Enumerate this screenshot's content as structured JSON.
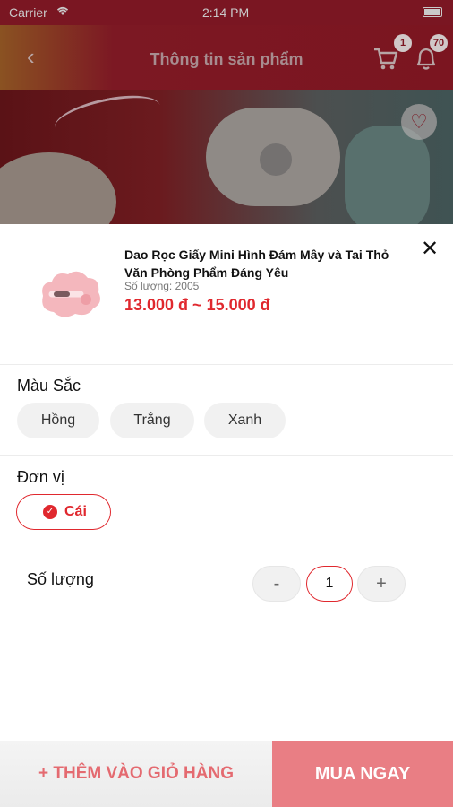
{
  "status_bar": {
    "carrier": "Carrier",
    "time": "2:14 PM"
  },
  "nav": {
    "title": "Thông tin sản phẩm",
    "cart_badge": "1",
    "notification_badge": "70"
  },
  "product": {
    "name": "Dao Rọc Giấy Mini Hình Đám Mây và Tai Thỏ Văn Phòng Phẩm Đáng Yêu",
    "quantity_text": "Số lượng: 2005",
    "price_range": "13.000 đ ~ 15.000 đ"
  },
  "color_section": {
    "label": "Màu Sắc",
    "options": [
      "Hồng",
      "Trắng",
      "Xanh"
    ]
  },
  "unit_section": {
    "label": "Đơn vị",
    "selected": "Cái"
  },
  "quantity_section": {
    "label": "Số lượng",
    "minus": "-",
    "value": "1",
    "plus": "+"
  },
  "footer": {
    "add_to_cart": "+ THÊM VÀO GIỎ HÀNG",
    "buy_now": "MUA NGAY"
  },
  "colors": {
    "accent": "#e0282e",
    "buy_button": "#e97e84",
    "header": "#7b1520"
  }
}
